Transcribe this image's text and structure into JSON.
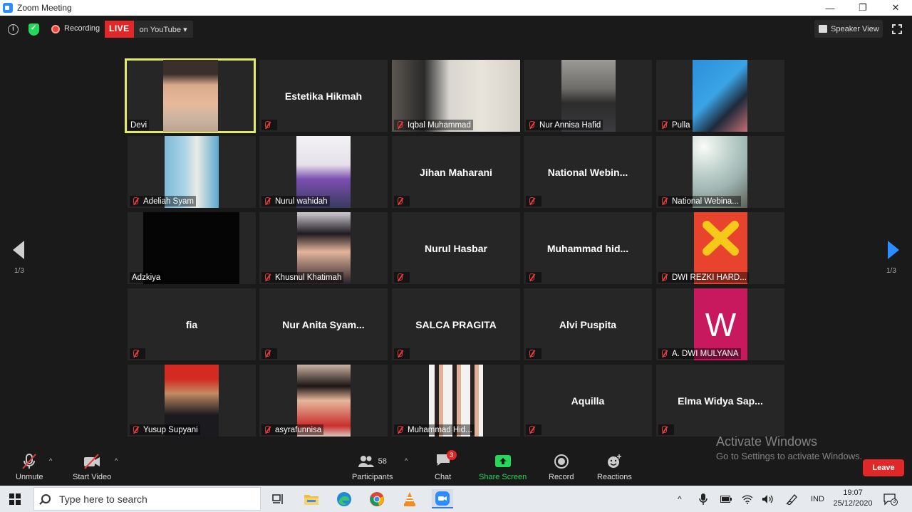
{
  "window": {
    "title": "Zoom Meeting",
    "controls": [
      "—",
      "❐",
      "✕"
    ]
  },
  "topbar": {
    "recording_label": "Recording",
    "live_badge": "LIVE",
    "live_target": "on YouTube",
    "speaker_view": "Speaker View"
  },
  "tiles": [
    {
      "name": "Devi",
      "type": "video",
      "muted": false,
      "active": true
    },
    {
      "name": "Estetika Hikmah",
      "type": "name",
      "muted": true
    },
    {
      "name": "Iqbal Muhammad",
      "type": "video",
      "muted": true
    },
    {
      "name": "Nur Annisa Hafid",
      "type": "video",
      "muted": true
    },
    {
      "name": "Pulla",
      "type": "video",
      "muted": true
    },
    {
      "name": "Adeliah Syam",
      "type": "video",
      "muted": true
    },
    {
      "name": "Nurul wahidah",
      "type": "video",
      "muted": true
    },
    {
      "name": "Jihan Maharani",
      "type": "name",
      "muted": true
    },
    {
      "name": "National  Webin...",
      "type": "name",
      "muted": true
    },
    {
      "name": "National Webina...",
      "type": "video",
      "muted": true
    },
    {
      "name": "Adzkiya",
      "type": "video",
      "muted": false
    },
    {
      "name": "Khusnul Khatimah",
      "type": "video",
      "muted": true
    },
    {
      "name": "Nurul Hasbar",
      "type": "name",
      "muted": true
    },
    {
      "name": "Muhammad  hid...",
      "type": "name",
      "muted": true
    },
    {
      "name": "DWI REZKI HARD...",
      "type": "logo-x",
      "muted": true
    },
    {
      "name": "fia",
      "type": "name",
      "muted": true
    },
    {
      "name": "Nur Anita Syam...",
      "type": "name",
      "muted": true
    },
    {
      "name": "SALCA PRAGITA",
      "type": "name",
      "muted": true
    },
    {
      "name": "Alvi Puspita",
      "type": "name",
      "muted": true
    },
    {
      "name": "A. DWI MULYANA",
      "type": "logo-w",
      "muted": true
    },
    {
      "name": "Yusup Supyani",
      "type": "video",
      "muted": true
    },
    {
      "name": "asyrafunnisa",
      "type": "video",
      "muted": true
    },
    {
      "name": "Muhammad Hid...",
      "type": "video",
      "muted": true
    },
    {
      "name": "Aquilla",
      "type": "name",
      "muted": true
    },
    {
      "name": "Elma  Widya Sap...",
      "type": "name",
      "muted": true
    }
  ],
  "logo_letters": {
    "w": "W"
  },
  "pagination": {
    "left": "1/3",
    "right": "1/3"
  },
  "toolbar": {
    "unmute": "Unmute",
    "start_video": "Start Video",
    "participants": "Participants",
    "participants_count": "58",
    "chat": "Chat",
    "chat_badge": "3",
    "share_screen": "Share Screen",
    "record": "Record",
    "reactions": "Reactions",
    "leave": "Leave"
  },
  "watermark": {
    "line1": "Activate Windows",
    "line2": "Go to Settings to activate Windows."
  },
  "taskbar": {
    "search_placeholder": "Type here to search",
    "language": "IND",
    "time": "19:07",
    "date": "25/12/2020",
    "notification_count": "3"
  },
  "colors": {
    "active_speaker": "#e4ea6e",
    "live": "#e02828",
    "share_screen": "#23d959",
    "nav_active": "#2d8cff"
  }
}
